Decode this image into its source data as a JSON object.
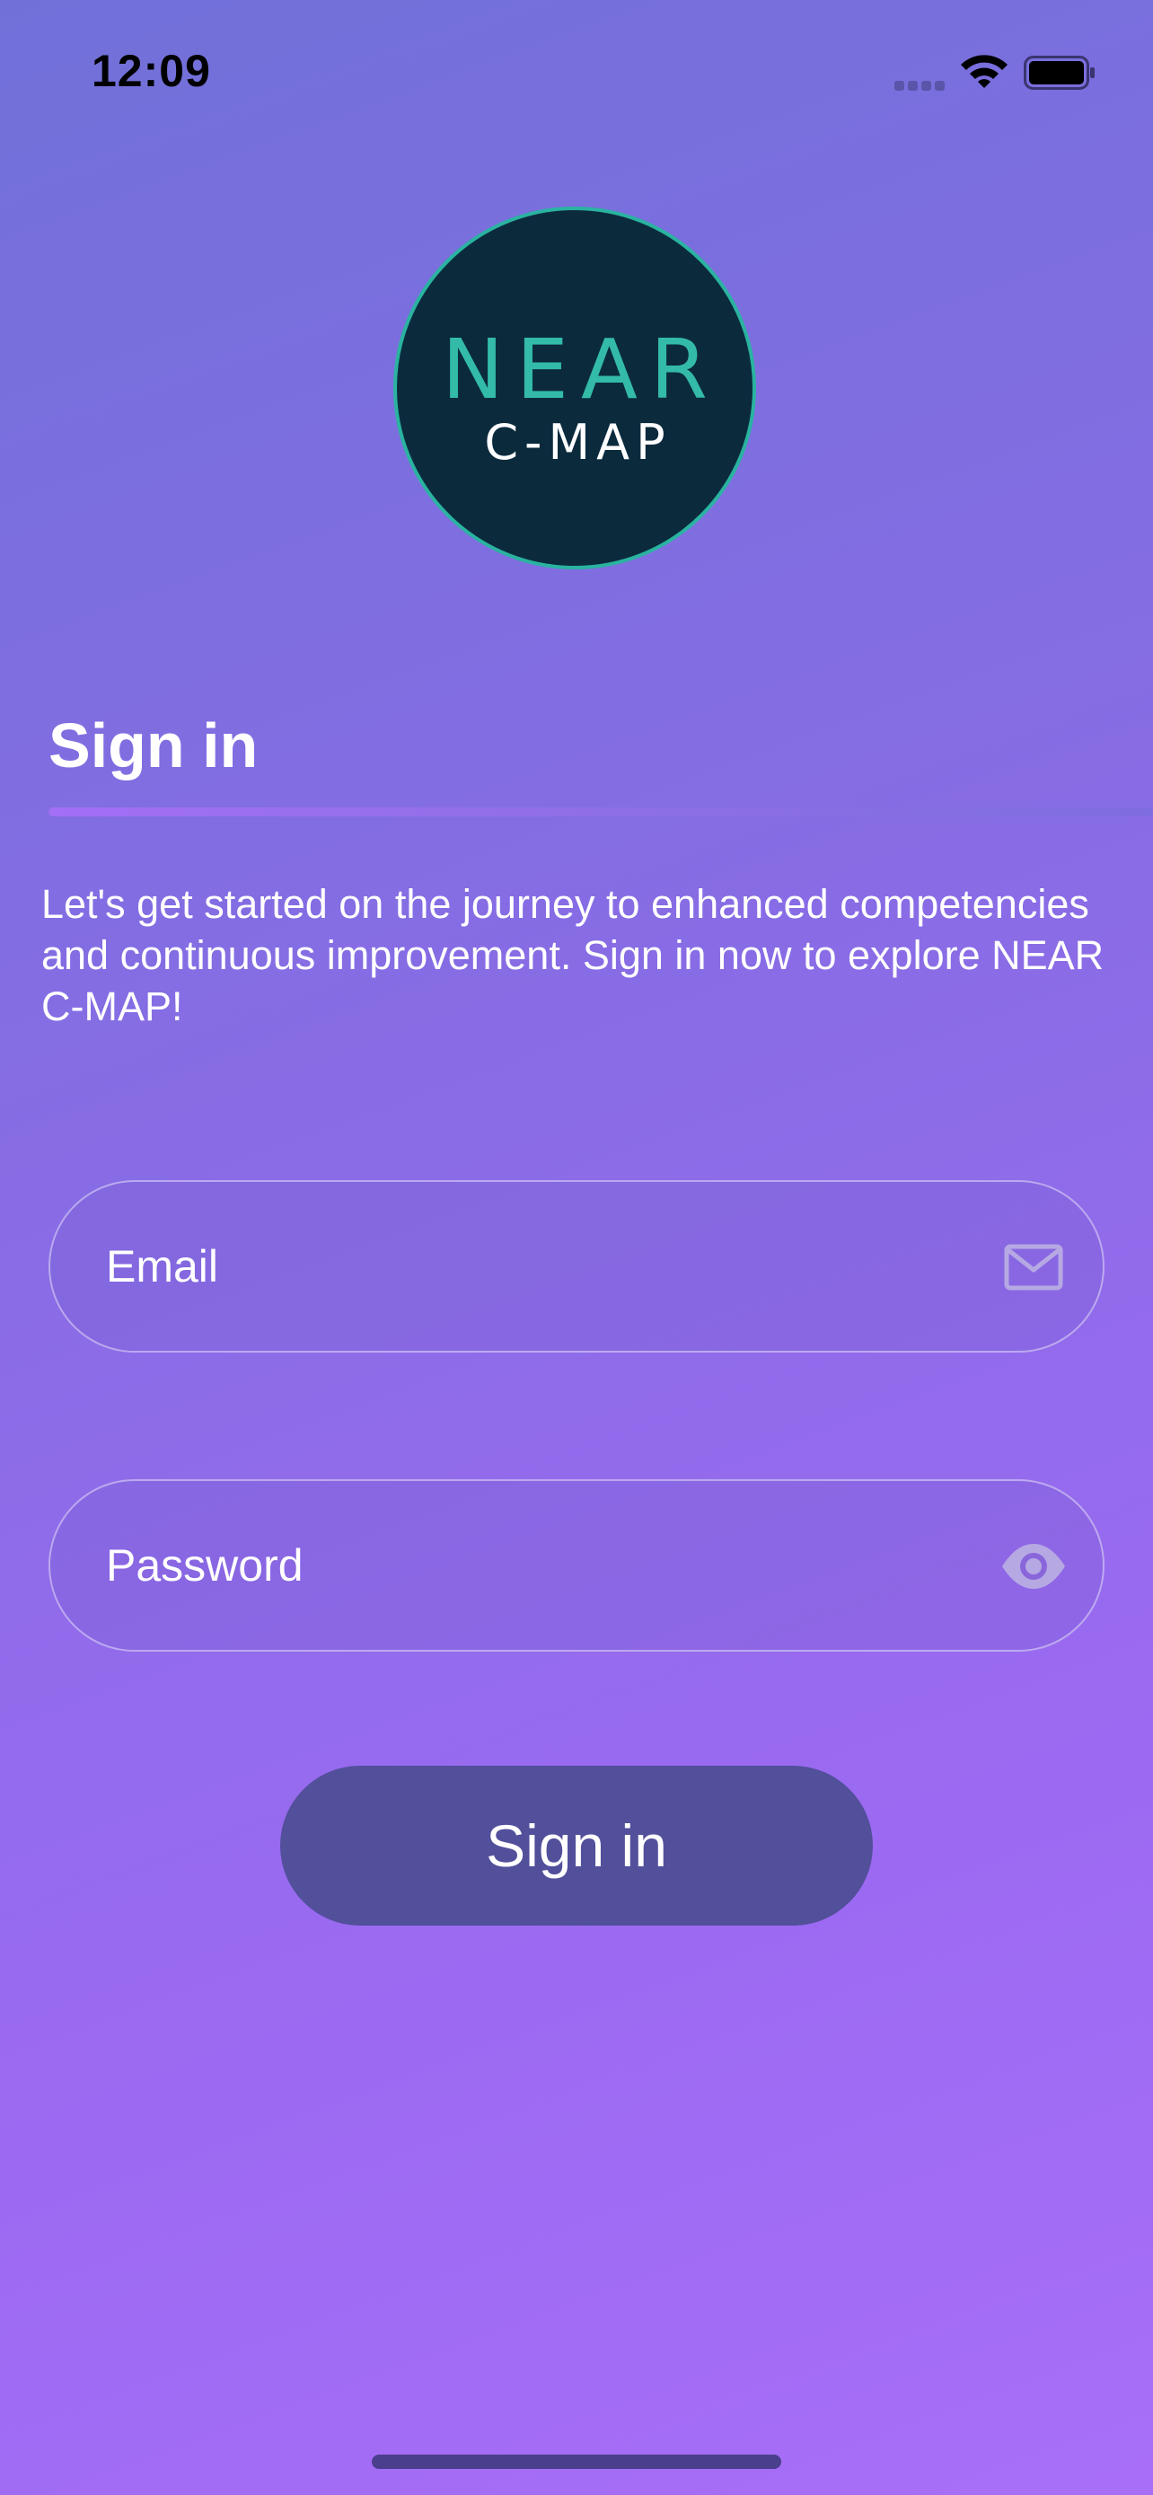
{
  "status_bar": {
    "time": "12:09",
    "icons": [
      "signal-dots-icon",
      "wifi-icon",
      "battery-icon"
    ]
  },
  "logo": {
    "line1": "NEAR",
    "line2": "C-MAP",
    "colors": {
      "background": "#0b2b3d",
      "accent": "#33bba8",
      "text": "#ffffff"
    }
  },
  "heading": {
    "title": "Sign in"
  },
  "intro": {
    "text": "Let's get started on the journey to enhanced competencies and continuous improvement. Sign in now to explore NEAR C-MAP!"
  },
  "form": {
    "email": {
      "placeholder": "Email",
      "value": "",
      "icon": "mail-icon"
    },
    "password": {
      "placeholder": "Password",
      "value": "",
      "icon": "eye-icon"
    },
    "submit_label": "Sign in"
  },
  "theme": {
    "gradient_start": "#7170d9",
    "gradient_end": "#a86ef7",
    "button_color": "#524f9b"
  }
}
